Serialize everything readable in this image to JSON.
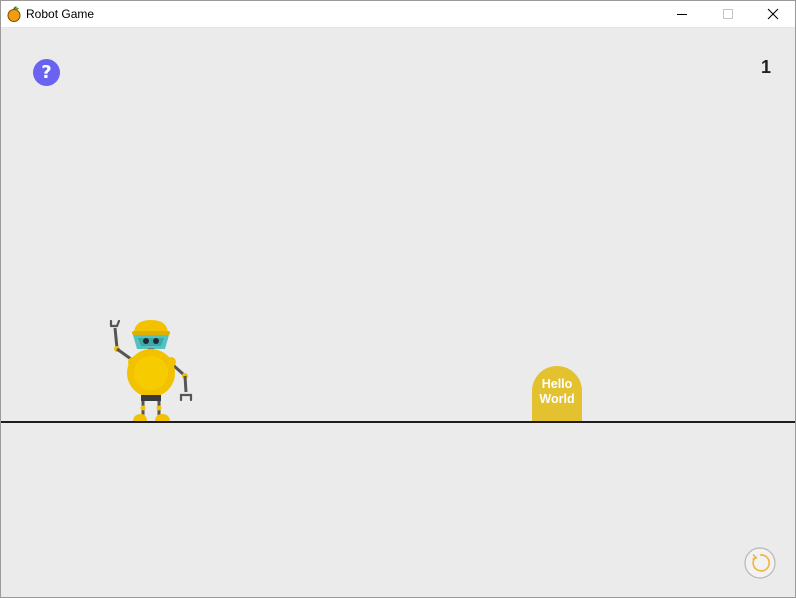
{
  "window": {
    "title": "Robot Game"
  },
  "game": {
    "help_symbol": "?",
    "score": "1",
    "sign_line1": "Hello",
    "sign_line2": "World"
  },
  "icons": {
    "app": "orange-icon",
    "help": "question-icon",
    "restart": "restart-icon",
    "robot": "robot-character"
  },
  "colors": {
    "background": "#ebebeb",
    "help_button": "#6a63f0",
    "sign": "#e3c12f",
    "robot_body": "#f2c200",
    "robot_visor": "#52c3c0",
    "ground": "#1e1e1e"
  }
}
